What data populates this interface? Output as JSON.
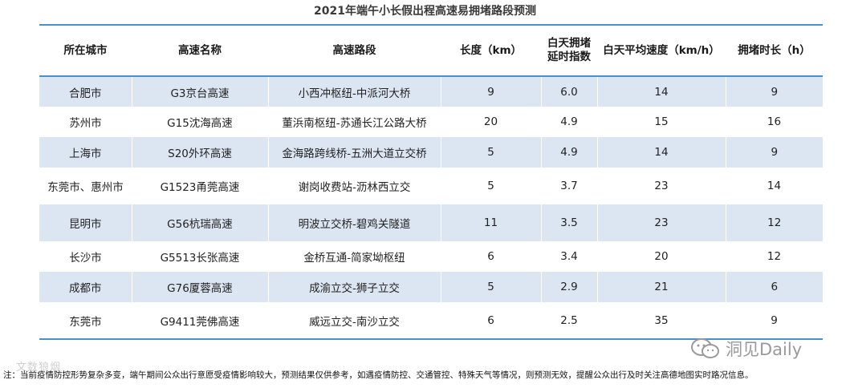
{
  "title": "2021年端午小长假出程高速易拥堵路段预测",
  "columns": [
    "所在城市",
    "高速名称",
    "高速路段",
    "长度（km）",
    "白天拥堵\n延时指数",
    "白天平均速度（km/h）",
    "拥堵时长（h）"
  ],
  "rows": [
    [
      "合肥市",
      "G3京台高速",
      "小西冲枢纽-中派河大桥",
      "9",
      "6.0",
      "14",
      "9"
    ],
    [
      "苏州市",
      "G15沈海高速",
      "董浜南枢纽-苏通长江公路大桥",
      "20",
      "4.9",
      "15",
      "16"
    ],
    [
      "上海市",
      "S20外环高速",
      "金海路跨线桥-五洲大道立交桥",
      "5",
      "4.9",
      "14",
      "9"
    ],
    [
      "东莞市、惠州市",
      "G1523甬莞高速",
      "谢岗收费站-沥林西立交",
      "5",
      "3.7",
      "23",
      "14"
    ],
    [
      "昆明市",
      "G56杭瑞高速",
      "明波立交桥-碧鸡关隧道",
      "11",
      "3.5",
      "23",
      "12"
    ],
    [
      "长沙市",
      "G5513长张高速",
      "金桥互通-简家坳枢纽",
      "6",
      "3.4",
      "20",
      "12"
    ],
    [
      "成都市",
      "G76厦蓉高速",
      "成渝立交-狮子立交",
      "5",
      "2.9",
      "21",
      "6"
    ],
    [
      "东莞市",
      "G9411莞佛高速",
      "威远立交-南沙立交",
      "6",
      "2.5",
      "35",
      "9"
    ]
  ],
  "watermark": "洞见Daily",
  "faint_watermark": "文数狼烟",
  "footnote": "注：当前疫情防控形势复杂多变，端午期间公众出行意愿受疫情影响较大，预测结果仅供参考，如遇疫情防控、交通管控、特殊天气等情况，则预测无效，提醒公众出行及时关注高德地图实时路况信息。"
}
